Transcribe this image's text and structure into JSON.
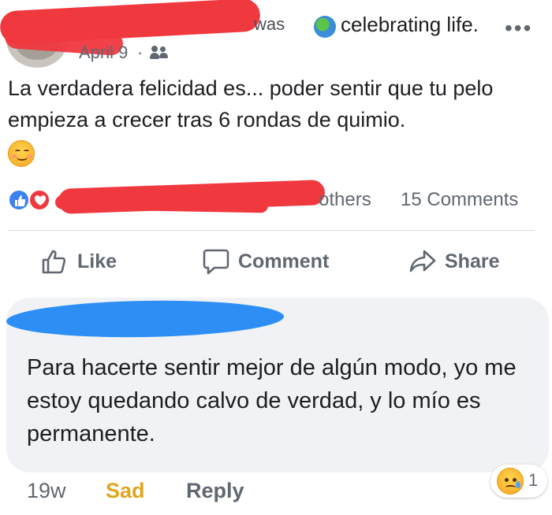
{
  "post": {
    "action_fragment": "was",
    "feeling": "celebrating life.",
    "more_glyph": "•••",
    "date": "April 9",
    "separator": "·",
    "audience_icon": "friends-icon",
    "text": "La verdadera felicidad es... poder sentir que tu pelo empieza a crecer tras 6 rondas de quimio.",
    "emoji": "smiling-face-icon"
  },
  "reactions": {
    "others_label": "others",
    "comments_label": "15 Comments"
  },
  "actions": {
    "like_label": "Like",
    "comment_label": "Comment",
    "share_label": "Share"
  },
  "comment": {
    "text": "Para hacerte sentir mejor de algún modo, yo me estoy quedando calvo de verdad, y lo mío es permanente.",
    "time": "19w",
    "reaction_label": "Sad",
    "reply_label": "Reply",
    "reaction_count": "1"
  },
  "colors": {
    "redaction_red": "#f0383f",
    "redaction_blue": "#2d8ff5",
    "sad_yellow": "#e0a61f",
    "muted_text": "#606770"
  }
}
